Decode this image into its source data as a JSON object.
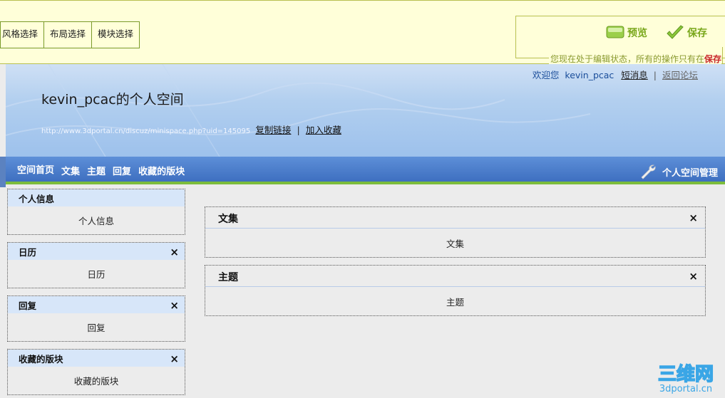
{
  "toolbar": {
    "tabs": [
      "风格选择",
      "布局选择",
      "模块选择"
    ],
    "preview_label": "预览",
    "save_label": "保存",
    "notice_prefix": "您现在处于编辑状态，所有的操作只有在",
    "notice_bold": "保存"
  },
  "header": {
    "welcome": "欢迎您",
    "username": "kevin_pcac",
    "messages": "短消息",
    "back_to_forum": "返回论坛",
    "space_title": "kevin_pcac的个人空间",
    "space_url": "http://www.3dportal.cn/discuz/minispace.php?uid=145095",
    "copy_link": "复制链接",
    "add_favorite": "加入收藏"
  },
  "nav": {
    "items": [
      "空间首页",
      "文集",
      "主题",
      "回复",
      "收藏的版块"
    ],
    "manage": "个人空间管理"
  },
  "sidebar": {
    "boxes": [
      {
        "title": "个人信息",
        "body": "个人信息",
        "closable": false
      },
      {
        "title": "日历",
        "body": "日历",
        "closable": true
      },
      {
        "title": "回复",
        "body": "回复",
        "closable": true
      },
      {
        "title": "收藏的版块",
        "body": "收藏的版块",
        "closable": true
      }
    ]
  },
  "main": {
    "boxes": [
      {
        "title": "文集",
        "body": "文集"
      },
      {
        "title": "主题",
        "body": "主题"
      }
    ]
  },
  "close_glyph": "×",
  "watermark": {
    "text": "三维网",
    "url": "3dportal.cn"
  },
  "colors": {
    "toolbar_bg": "#ffffd9",
    "action_green": "#7aa81c",
    "nav_blue": "#4a7cc8",
    "nav_accent": "#7cbc3c",
    "box_head": "#d7e6f9",
    "notice_red": "#c8282c"
  }
}
